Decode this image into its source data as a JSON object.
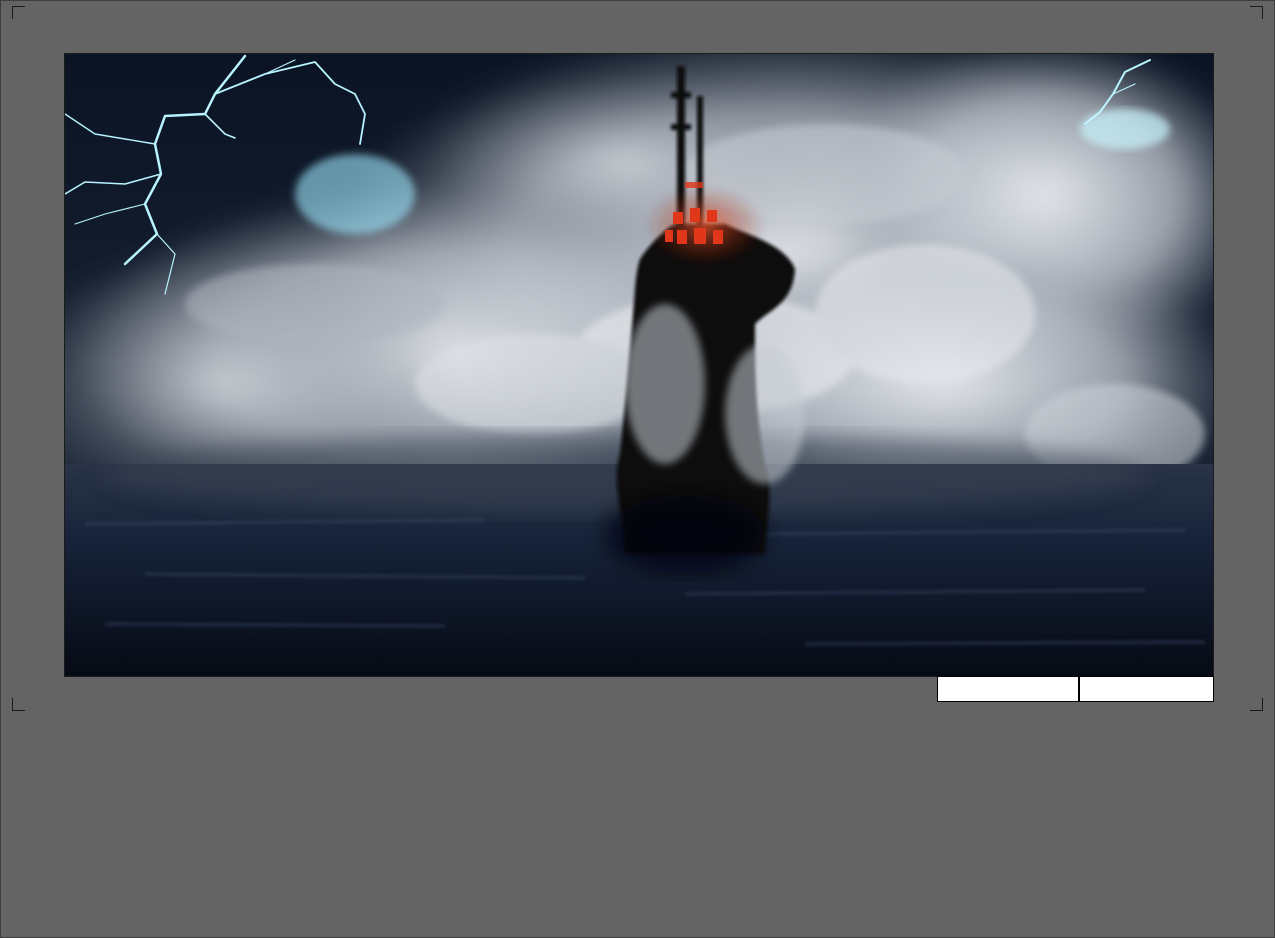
{
  "scene": {
    "subject": "storm-wave-over-lighthouse",
    "colors": {
      "background": "#646464",
      "sky": "#0e1a2e",
      "sea": "#0c1628",
      "spray": "#c8ccd2",
      "lightning": "#b8f4ff",
      "window_glow": "#e0361a"
    }
  },
  "caption_fields": {
    "left": "",
    "right": ""
  }
}
